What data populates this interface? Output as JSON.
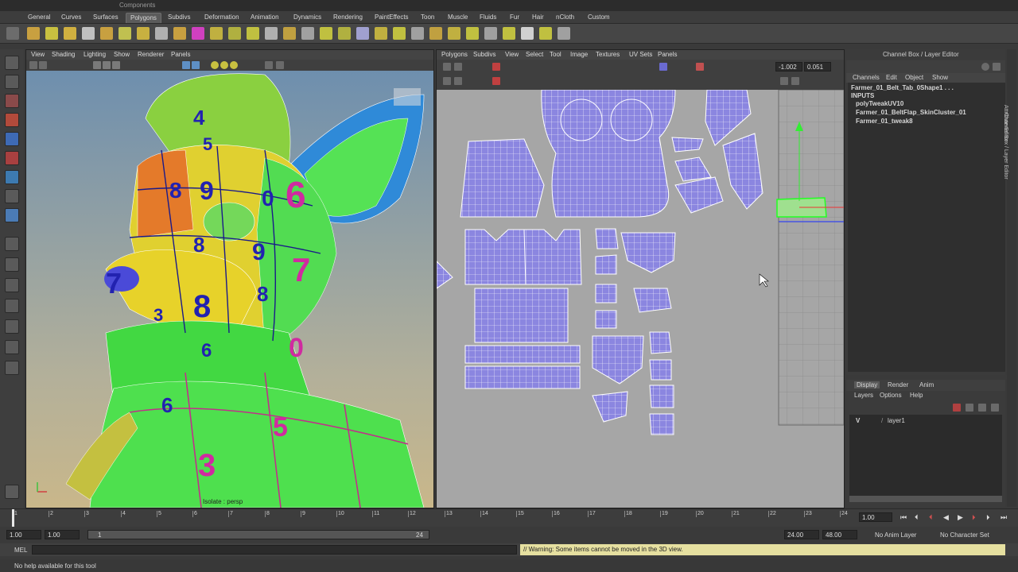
{
  "window": {
    "title_fragment": "Components"
  },
  "shelf": {
    "tabs": [
      "General",
      "Curves",
      "Surfaces",
      "Polygons",
      "Subdivs",
      "Deformation",
      "Animation",
      "Dynamics",
      "Rendering",
      "PaintEffects",
      "Toon",
      "Muscle",
      "Fluids",
      "Fur",
      "Hair",
      "nCloth",
      "Custom"
    ],
    "active_tab": "Polygons"
  },
  "viewport3d": {
    "menu": [
      "View",
      "Shading",
      "Lighting",
      "Show",
      "Renderer",
      "Panels"
    ],
    "hud_text": "Isolate : persp",
    "numbers_on_model": [
      "4",
      "5",
      "8",
      "9",
      "0",
      "6",
      "8",
      "9",
      "7",
      "8",
      "8",
      "7",
      "3",
      "6",
      "0",
      "5",
      "3",
      "6"
    ]
  },
  "uv_editor": {
    "menu": [
      "Polygons",
      "Subdivs",
      "View",
      "Select",
      "Tool",
      "Image",
      "Textures",
      "UV Sets",
      "Panels"
    ],
    "u_value": "-1.002",
    "v_value": "0.051"
  },
  "channel_box": {
    "title": "Channel Box / Layer Editor",
    "menu": [
      "Channels",
      "Edit",
      "Object",
      "Show"
    ],
    "object_name": "Farmer_01_Belt_Tab_0Shape1 . . .",
    "inputs_label": "INPUTS",
    "inputs": [
      "polyTweakUV10",
      "Farmer_01_BeltFlap_SkinCluster_01",
      "Farmer_01_tweak8"
    ],
    "side_tabs": [
      "Attribute Editor",
      "Channel Box / Layer Editor"
    ]
  },
  "layer_editor": {
    "tabs": [
      "Display",
      "Render",
      "Anim"
    ],
    "active_tab": "Display",
    "menu": [
      "Layers",
      "Options",
      "Help"
    ],
    "layers": [
      {
        "visible": "V",
        "name": "layer1"
      }
    ]
  },
  "timeline": {
    "ticks": [
      "1",
      "2",
      "3",
      "4",
      "5",
      "6",
      "7",
      "8",
      "9",
      "10",
      "11",
      "12",
      "13",
      "14",
      "15",
      "16",
      "17",
      "18",
      "19",
      "20",
      "21",
      "22",
      "23",
      "24"
    ],
    "current_frame": "1.00"
  },
  "range_slider": {
    "start_time": "1.00",
    "playback_start": "1.00",
    "range_start_label": "1",
    "range_end_label": "24",
    "playback_end": "24.00",
    "end_time": "48.00",
    "anim_layer": "No Anim Layer",
    "character_set": "No Character Set"
  },
  "command_line": {
    "label": "MEL",
    "feedback": "// Warning: Some items cannot be moved in the 3D view."
  },
  "help_line": {
    "text": "No help available for this tool"
  },
  "colors": {
    "uv_shell": "#8b86e0",
    "uv_bg": "#a6a6a6",
    "model_green": "#4ee04e",
    "warning_bg": "#e6e0a0"
  }
}
